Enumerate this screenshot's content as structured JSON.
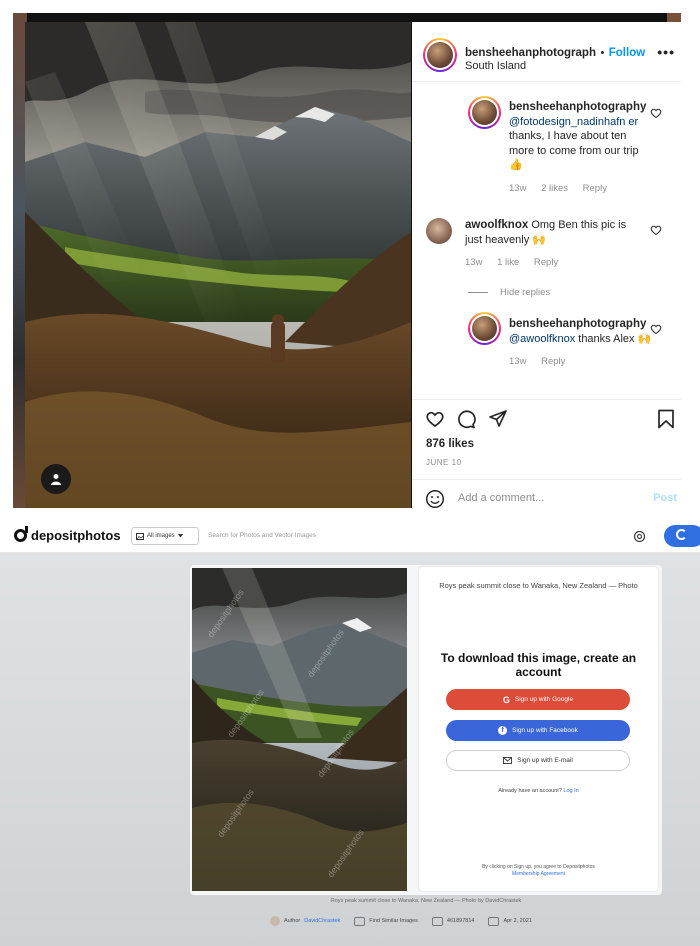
{
  "instagram": {
    "post": {
      "username": "bensheehanphotograph",
      "dot": "•",
      "follow_label": "Follow",
      "location": "South Island",
      "more_label": "•••"
    },
    "comments": [
      {
        "username": "bensheehanphotography",
        "mention": "@fotodesign_nadinhafn er",
        "text": " thanks, I have about ten more to come from our trip 👍",
        "age": "13w",
        "likes": "2 likes",
        "reply": "Reply"
      },
      {
        "username": "awoolfknox",
        "text": " Omg Ben this pic is just heavenly 🙌",
        "age": "13w",
        "likes": "1 like",
        "reply": "Reply"
      },
      {
        "username": "bensheehanphotography",
        "mention": "@awoolfknox",
        "text": " thanks Alex 🙌",
        "age": "13w",
        "reply": "Reply"
      }
    ],
    "hide_replies": "Hide replies",
    "likes_count": "876 likes",
    "date": "JUNE 10",
    "add_comment_placeholder": "Add a comment...",
    "post_label": "Post"
  },
  "depositphotos": {
    "logo": "depositphotos",
    "filter_label": "All images",
    "search_placeholder": "Search for Photos and Vector Images",
    "photo_title": "Roys peak summit close to Wanaka, New Zealand — Photo",
    "cta": "To download this image, create an account",
    "google_label": "Sign up with Google",
    "facebook_label": "Sign up with Facebook",
    "email_label": "Sign up with E-mail",
    "have_account": "Already have an account?",
    "login_label": "Log In",
    "terms_text": "By clicking on Sign up, you agree to Depositphotos",
    "terms_link": "Membership Agreement",
    "caption": "Roys peak summit close to Wanaka, New Zealand — Photo by DavidChrastek",
    "author_label": "Author",
    "author_name": "DavidChrastek",
    "similar_label": "Find Similar Images",
    "image_id": "461897814",
    "upload_date": "Apr 2, 2021",
    "watermark": "depositphotos"
  }
}
